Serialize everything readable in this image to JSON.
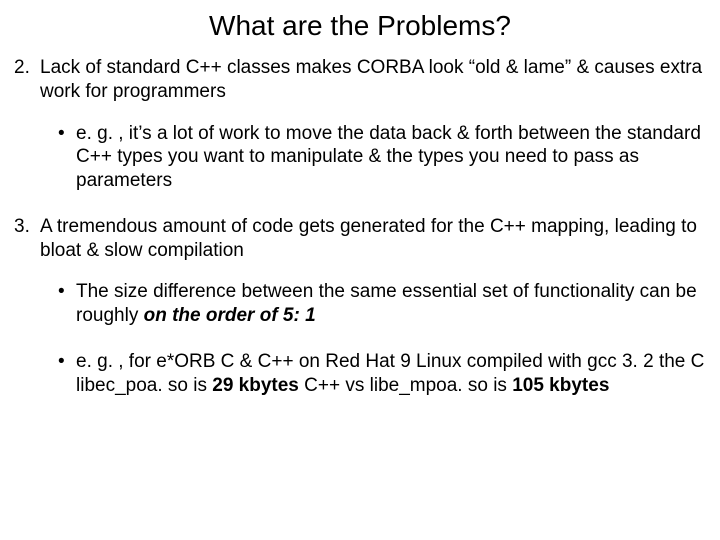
{
  "title": "What are the Problems?",
  "item2": {
    "marker": "2.",
    "text": "Lack of standard C++ classes makes CORBA look “old & lame” & causes extra work for programmers",
    "sub1": "e. g. , it’s a lot of work to move the data back & forth between the standard C++ types you want to manipulate & the types you need to pass as parameters"
  },
  "item3": {
    "marker": "3.",
    "text": "A tremendous amount of code gets generated for the C++ mapping, leading to bloat & slow compilation",
    "sub1_a": "The size difference between the same essential set of functionality can be roughly ",
    "sub1_b": "on the order of 5: 1",
    "sub2_a": "e. g. , for e*ORB C & C++ on Red Hat 9 Linux compiled with gcc 3. 2 the C libec_poa. so is ",
    "sub2_b": "29 kbytes",
    "sub2_c": " C++ vs libe_mpoa. so is ",
    "sub2_d": "105 kbytes"
  }
}
